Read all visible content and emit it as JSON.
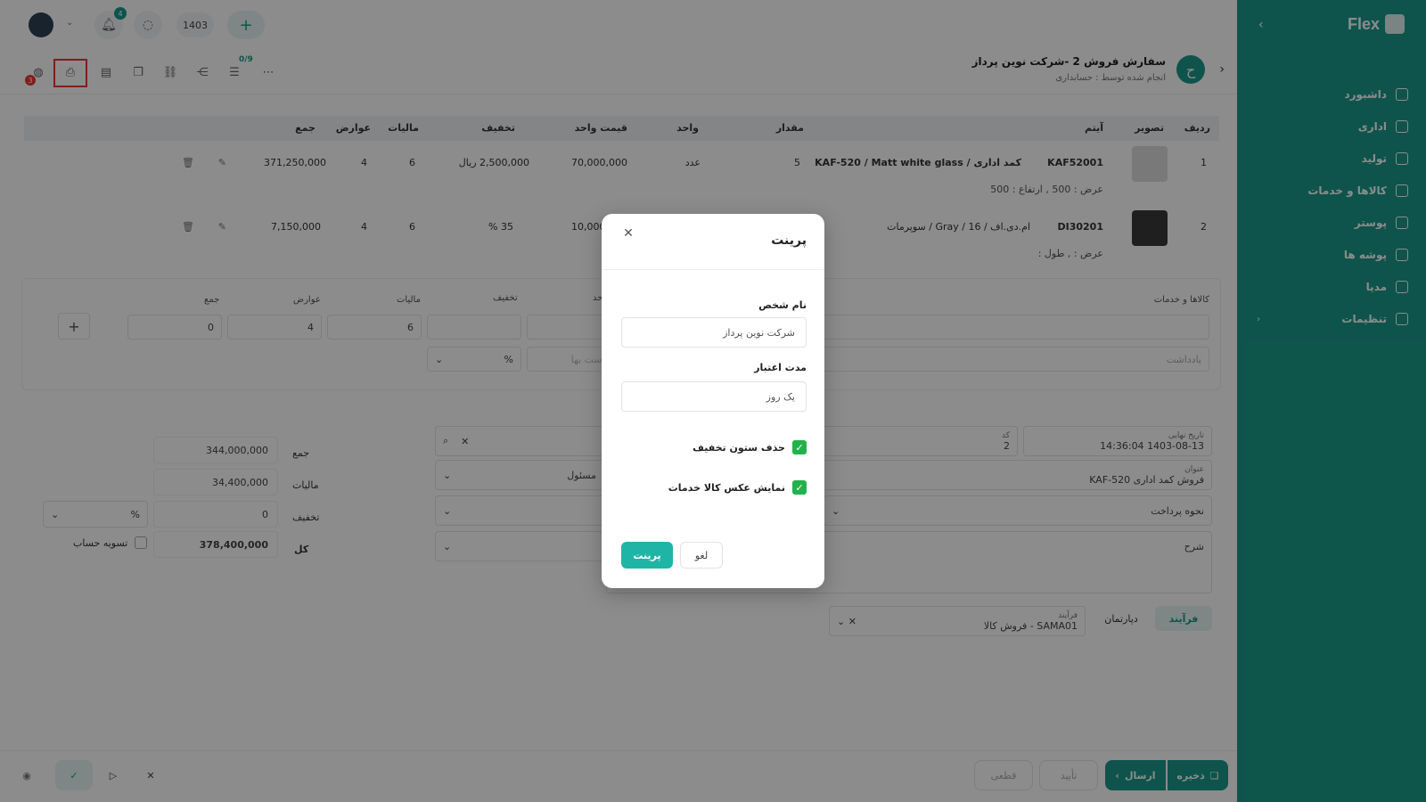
{
  "topbar": {
    "notifications_count": "4",
    "year": "1403"
  },
  "sidebar": {
    "brand": "Flex",
    "items": [
      {
        "label": "داشبورد",
        "icon": "home-icon"
      },
      {
        "label": "اداری",
        "icon": "briefcase-icon"
      },
      {
        "label": "تولید",
        "icon": "tools-icon"
      },
      {
        "label": "کالاها و خدمات",
        "icon": "box-icon"
      },
      {
        "label": "پوستر",
        "icon": "poster-icon"
      },
      {
        "label": "پوشه ها",
        "icon": "folder-icon"
      },
      {
        "label": "مدیا",
        "icon": "media-icon"
      },
      {
        "label": "تنظیمات",
        "icon": "gear-icon"
      }
    ]
  },
  "header": {
    "title": "سفارش فروش 2 -شرکت نوین پرداز",
    "subtitle": "انجام شده توسط : حسابداری",
    "avatar_letter": "ح",
    "counter": "0/9",
    "chat_badge": "3"
  },
  "table": {
    "headers": {
      "row": "ردیف",
      "image": "تصویر",
      "item": "آیتم",
      "qty": "مقدار",
      "unit": "واحد",
      "unit_price": "قیمت واحد",
      "discount": "تخفیف",
      "tax": "مالیات",
      "duties": "عوارض",
      "total": "جمع"
    },
    "rows": [
      {
        "row": "1",
        "code": "KAF52001",
        "name": "کمد اداری / KAF-520 / Matt white glass",
        "dims": "عرض : 500 , ارتفاع : 500",
        "qty": "5",
        "unit": "عدد",
        "unit_price": "70,000,000",
        "discount": "2,500,000 ریال",
        "tax": "6",
        "duties": "4",
        "total": "371,250,000"
      },
      {
        "row": "2",
        "code": "DI30201",
        "name": "ام.دی.اف / 16 / Gray / سوپرمات",
        "dims": "عرض : , طول :",
        "qty": "",
        "unit": "",
        "unit_price": "10,000,000",
        "discount": "35 %",
        "tax": "6",
        "duties": "4",
        "total": "7,150,000"
      }
    ]
  },
  "add_item": {
    "goods_label": "کالاها و خدمات",
    "unit_price_label": "قیمت واحد",
    "discount_label": "تخفیف",
    "tax_label": "مالیات",
    "duties_label": "عوارض",
    "total_label": "جمع",
    "tax_value": "6",
    "duties_value": "4",
    "total_value": "0",
    "percent": "%",
    "price_list_placeholder": "فهرست بها",
    "note_placeholder": "یادداشت"
  },
  "form": {
    "end_date_label": "تاریخ نهایی",
    "end_date_value": "1403-08-13 14:36:04",
    "code_label": "کد",
    "code_value": "2",
    "title_label": "عنوان",
    "title_value": "فروش کمد اداری KAF-520",
    "responsible_label": "مسئول",
    "payment_label": "نحوه پرداخت",
    "desc_label": "شرح",
    "process_tab": "فرآیند",
    "department_tab": "دپارتمان",
    "process_label": "فرآیند",
    "process_value": "SAMA01 - فروش کالا"
  },
  "summary": {
    "sum_label": "جمع",
    "sum_value": "344,000,000",
    "tax_label": "مالیات",
    "tax_value": "34,400,000",
    "discount_label": "تخفیف",
    "discount_value": "0",
    "percent": "%",
    "total_label": "کل",
    "total_value": "378,400,000",
    "settle_label": "تسویه حساب"
  },
  "footer": {
    "save": "ذخیره",
    "send": "ارسال",
    "confirm": "تأیید",
    "final": "قطعی"
  },
  "dialog": {
    "title": "پرینت",
    "person_label": "نام شخص",
    "person_value": "شرکت نوین پرداز",
    "validity_label": "مدت اعتبار",
    "validity_value": "یک روز",
    "remove_discount": "حذف ستون تخفیف",
    "show_image": "نمایش عکس کالا خدمات",
    "print_btn": "پرینت",
    "cancel_btn": "لغو"
  },
  "colors": {
    "accent": "#1a9a8b",
    "check": "#22b24c",
    "highlight": "#e53935"
  }
}
